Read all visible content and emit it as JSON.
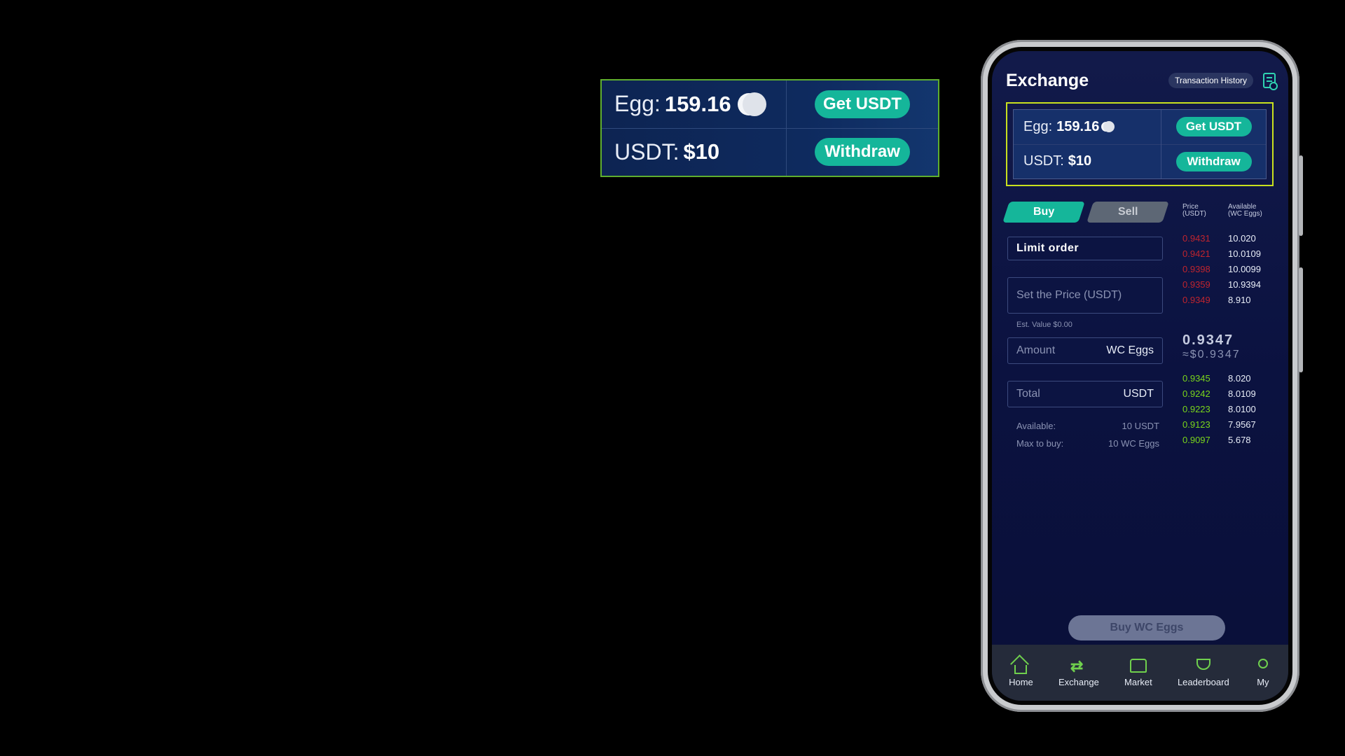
{
  "callout": {
    "egg_label": "Egg:",
    "egg_value": "159.16",
    "usdt_label": "USDT:",
    "usdt_value": "$10",
    "get_usdt": "Get USDT",
    "withdraw": "Withdraw"
  },
  "header": {
    "title": "Exchange",
    "transaction_history": "Transaction History"
  },
  "balance": {
    "egg_label": "Egg:",
    "egg_value": "159.16",
    "usdt_label": "USDT:",
    "usdt_value": "$10",
    "get_usdt": "Get USDT",
    "withdraw": "Withdraw"
  },
  "tabs": {
    "buy": "Buy",
    "sell": "Sell"
  },
  "form": {
    "order_type": "Limit order",
    "price_placeholder": "Set the Price (USDT)",
    "est_value": "Est. Value $0.00",
    "amount_placeholder": "Amount",
    "amount_unit": "WC Eggs",
    "total_placeholder": "Total",
    "total_unit": "USDT",
    "available_label": "Available:",
    "available_value": "10 USDT",
    "max_label": "Max to buy:",
    "max_value": "10 WC Eggs"
  },
  "orderbook": {
    "price_header_1": "Price",
    "price_header_2": "(USDT)",
    "avail_header_1": "Available",
    "avail_header_2": "(WC Eggs)",
    "asks": [
      {
        "price": "0.9431",
        "qty": "10.020"
      },
      {
        "price": "0.9421",
        "qty": "10.0109"
      },
      {
        "price": "0.9398",
        "qty": "10.0099"
      },
      {
        "price": "0.9359",
        "qty": "10.9394"
      },
      {
        "price": "0.9349",
        "qty": "8.910"
      }
    ],
    "last_price": "0.9347",
    "last_price_usd": "≈$0.9347",
    "bids": [
      {
        "price": "0.9345",
        "qty": "8.020"
      },
      {
        "price": "0.9242",
        "qty": "8.0109"
      },
      {
        "price": "0.9223",
        "qty": "8.0100"
      },
      {
        "price": "0.9123",
        "qty": "7.9567"
      },
      {
        "price": "0.9097",
        "qty": "5.678"
      }
    ]
  },
  "buy_button": "Buy WC Eggs",
  "nav": {
    "home": "Home",
    "exchange": "Exchange",
    "market": "Market",
    "leaderboard": "Leaderboard",
    "my": "My"
  },
  "colors": {
    "accent": "#15b69a",
    "highlight_border": "#c9e11e",
    "ask": "#c0242e",
    "bid": "#7ad61a",
    "nav_icon": "#6fd04d"
  }
}
